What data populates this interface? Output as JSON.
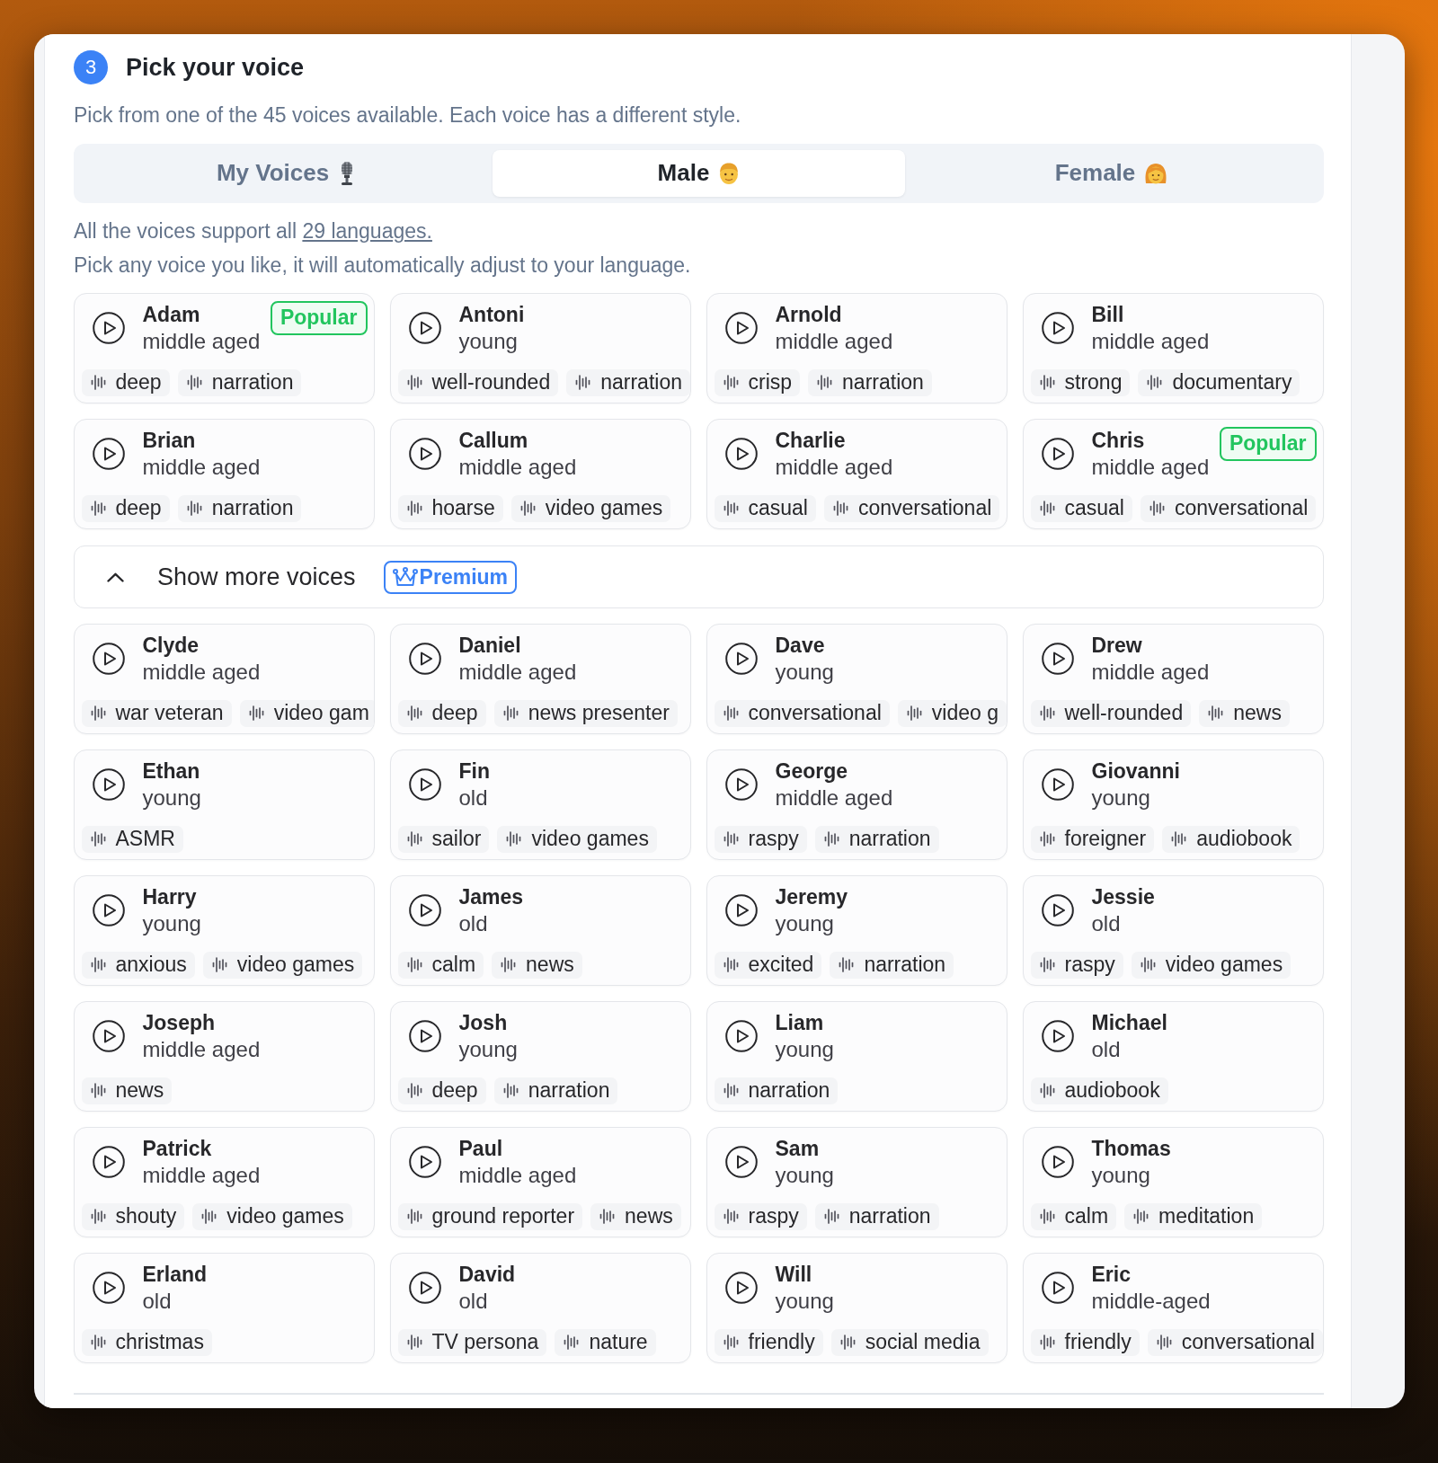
{
  "step": {
    "number": "3",
    "title": "Pick your voice"
  },
  "subtitle": "Pick from one of the 45 voices available. Each voice has a different style.",
  "tabs": [
    {
      "label": "My Voices",
      "selected": false
    },
    {
      "label": "Male",
      "selected": true
    },
    {
      "label": "Female",
      "selected": false
    }
  ],
  "languages_note": {
    "text": "All the voices support all",
    "link": "29 languages."
  },
  "hint": "Pick any voice you like, it will automatically adjust to your language.",
  "voices": [
    {
      "name": "Adam",
      "age": "middle aged",
      "badge": "Popular",
      "tags": [
        "deep",
        "narration"
      ]
    },
    {
      "name": "Antoni",
      "age": "young",
      "tags": [
        "well-rounded",
        "narration"
      ]
    },
    {
      "name": "Arnold",
      "age": "middle aged",
      "tags": [
        "crisp",
        "narration"
      ]
    },
    {
      "name": "Bill",
      "age": "middle aged",
      "tags": [
        "strong",
        "documentary"
      ]
    },
    {
      "name": "Brian",
      "age": "middle aged",
      "tags": [
        "deep",
        "narration"
      ]
    },
    {
      "name": "Callum",
      "age": "middle aged",
      "tags": [
        "hoarse",
        "video games"
      ]
    },
    {
      "name": "Charlie",
      "age": "middle aged",
      "tags": [
        "casual",
        "conversational"
      ]
    },
    {
      "name": "Chris",
      "age": "middle aged",
      "badge": "Popular",
      "tags": [
        "casual",
        "conversational"
      ]
    }
  ],
  "more": {
    "label": "Show more voices",
    "expanded": true,
    "badge": "Premium"
  },
  "more_voices": [
    {
      "name": "Clyde",
      "age": "middle aged",
      "tags": [
        "war veteran",
        "video gam"
      ]
    },
    {
      "name": "Daniel",
      "age": "middle aged",
      "tags": [
        "deep",
        "news presenter"
      ]
    },
    {
      "name": "Dave",
      "age": "young",
      "tags": [
        "conversational",
        "video g"
      ]
    },
    {
      "name": "Drew",
      "age": "middle aged",
      "tags": [
        "well-rounded",
        "news"
      ]
    },
    {
      "name": "Ethan",
      "age": "young",
      "tags": [
        "ASMR"
      ]
    },
    {
      "name": "Fin",
      "age": "old",
      "tags": [
        "sailor",
        "video games"
      ]
    },
    {
      "name": "George",
      "age": "middle aged",
      "tags": [
        "raspy",
        "narration"
      ]
    },
    {
      "name": "Giovanni",
      "age": "young",
      "tags": [
        "foreigner",
        "audiobook"
      ]
    },
    {
      "name": "Harry",
      "age": "young",
      "tags": [
        "anxious",
        "video games"
      ]
    },
    {
      "name": "James",
      "age": "old",
      "tags": [
        "calm",
        "news"
      ]
    },
    {
      "name": "Jeremy",
      "age": "young",
      "tags": [
        "excited",
        "narration"
      ]
    },
    {
      "name": "Jessie",
      "age": "old",
      "tags": [
        "raspy",
        "video games"
      ]
    },
    {
      "name": "Joseph",
      "age": "middle aged",
      "tags": [
        "news"
      ]
    },
    {
      "name": "Josh",
      "age": "young",
      "tags": [
        "deep",
        "narration"
      ]
    },
    {
      "name": "Liam",
      "age": "young",
      "tags": [
        "narration"
      ]
    },
    {
      "name": "Michael",
      "age": "old",
      "tags": [
        "audiobook"
      ]
    },
    {
      "name": "Patrick",
      "age": "middle aged",
      "tags": [
        "shouty",
        "video games"
      ]
    },
    {
      "name": "Paul",
      "age": "middle aged",
      "tags": [
        "ground reporter",
        "news"
      ]
    },
    {
      "name": "Sam",
      "age": "young",
      "tags": [
        "raspy",
        "narration"
      ]
    },
    {
      "name": "Thomas",
      "age": "young",
      "tags": [
        "calm",
        "meditation"
      ]
    },
    {
      "name": "Erland",
      "age": "old",
      "tags": [
        "christmas"
      ]
    },
    {
      "name": "David",
      "age": "old",
      "tags": [
        "TV persona",
        "nature"
      ]
    },
    {
      "name": "Will",
      "age": "young",
      "tags": [
        "friendly",
        "social media"
      ]
    },
    {
      "name": "Eric",
      "age": "middle-aged",
      "tags": [
        "friendly",
        "conversational"
      ]
    }
  ]
}
